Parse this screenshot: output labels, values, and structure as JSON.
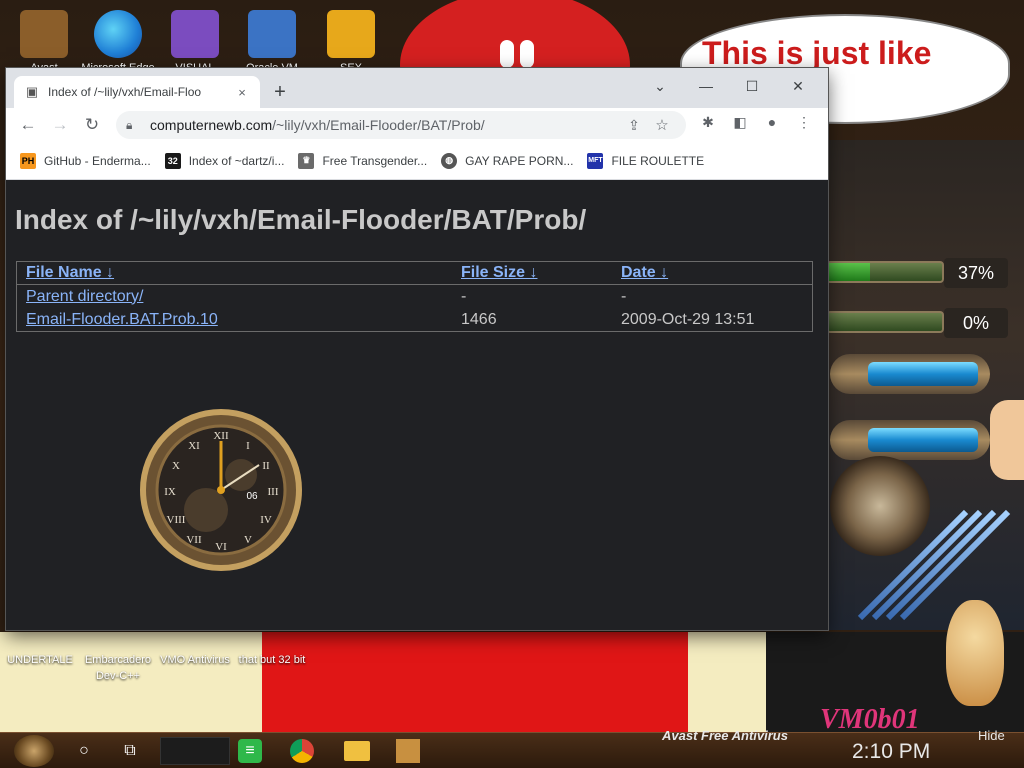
{
  "desktop": {
    "bubble_text": "This is just like Orwell's",
    "icons_top": [
      {
        "label": "Avast",
        "color": "#8b5e2a"
      },
      {
        "label": "Microsoft Edge",
        "color": "#1f7fd6"
      },
      {
        "label": "VISUAL",
        "color": "#7b4cbf"
      },
      {
        "label": "Oracle VM",
        "color": "#3b73c4"
      },
      {
        "label": "SEX",
        "color": "#e7a81b"
      }
    ],
    "icons_bottom": [
      {
        "label": "UNDERTALE"
      },
      {
        "label": "Embarcadero Dev-C++"
      },
      {
        "label": "VMO Antivirus"
      },
      {
        "label": "that but 32 bit"
      }
    ],
    "gauges": [
      {
        "label": "37%",
        "fill": 0.37
      },
      {
        "label": "0%",
        "fill": 0.0
      }
    ],
    "vm_text": "VM0b01"
  },
  "browser": {
    "tab": {
      "title": "Index of /~lily/vxh/Email-Floo",
      "close": "×"
    },
    "new_tab": "+",
    "window_buttons": {
      "dropdown": "⌄",
      "minimize": "—",
      "maximize": "☐",
      "close": "✕"
    },
    "nav": {
      "back": "←",
      "forward": "→",
      "reload": "↻"
    },
    "url": {
      "host": "computernewb.com",
      "path": "/~lily/vxh/Email-Flooder/BAT/Prob/"
    },
    "bookmarks": [
      {
        "label": "GitHub - Enderma...",
        "icon": "PH",
        "color": "#f7971d"
      },
      {
        "label": "Index of ~dartz/i...",
        "icon": "32",
        "color": "#1a1a1a"
      },
      {
        "label": "Free Transgender...",
        "icon": "♛",
        "color": "#6a6a6a"
      },
      {
        "label": "GAY RAPE PORN...",
        "icon": "◍",
        "color": "#555555"
      },
      {
        "label": "FILE ROULETTE",
        "icon": "MFT",
        "color": "#2233aa"
      }
    ]
  },
  "page": {
    "heading": "Index of /~lily/vxh/Email-Flooder/BAT/Prob/",
    "columns": [
      "File Name  ↓",
      "File Size  ↓",
      "Date  ↓"
    ],
    "rows": [
      {
        "name": "Parent directory/",
        "size": "-",
        "date": "-"
      },
      {
        "name": "Email-Flooder.BAT.Prob.10",
        "size": "1466",
        "date": "2009-Oct-29 13:51"
      }
    ],
    "clock_number": "06"
  },
  "taskbar": {
    "tray_app": "Avast Free Antivirus",
    "time": "2:10 PM",
    "hide": "Hide"
  }
}
